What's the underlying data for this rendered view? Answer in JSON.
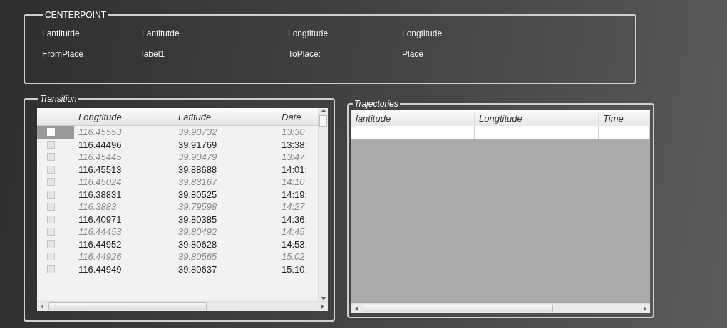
{
  "centerpoint": {
    "title": "CENTERPOINT",
    "rows": [
      [
        "Lantitutde",
        "Lantitutde",
        "Longtitude",
        "Longtitude"
      ],
      [
        "FromPlace",
        "label1",
        "ToPlace:",
        "Place"
      ]
    ]
  },
  "transition": {
    "title": "Transition",
    "columns": [
      "Longtitude",
      "Latitude",
      "Date"
    ],
    "rows": [
      {
        "kind": "alternate",
        "selected": true,
        "cells": [
          "116.45553",
          "39.90732",
          "13:30"
        ]
      },
      {
        "kind": "normal",
        "selected": false,
        "cells": [
          "116.44496",
          "39.91769",
          "13:38:"
        ]
      },
      {
        "kind": "alternate",
        "selected": false,
        "cells": [
          "116.45445",
          "39.90479",
          "13:47"
        ]
      },
      {
        "kind": "normal",
        "selected": false,
        "cells": [
          "116.45513",
          "39.88688",
          "14:01:"
        ]
      },
      {
        "kind": "alternate",
        "selected": false,
        "cells": [
          "116.45024",
          "39.83167",
          "14:10"
        ]
      },
      {
        "kind": "normal",
        "selected": false,
        "cells": [
          "116.38831",
          "39.80525",
          "14:19:"
        ]
      },
      {
        "kind": "alternate",
        "selected": false,
        "cells": [
          "116.3883",
          "39.79598",
          "14:27"
        ]
      },
      {
        "kind": "normal",
        "selected": false,
        "cells": [
          "116.40971",
          "39.80385",
          "14:36:"
        ]
      },
      {
        "kind": "alternate",
        "selected": false,
        "cells": [
          "116.44453",
          "39.80492",
          "14:45"
        ]
      },
      {
        "kind": "normal",
        "selected": false,
        "cells": [
          "116.44952",
          "39.80628",
          "14:53:"
        ]
      },
      {
        "kind": "alternate",
        "selected": false,
        "cells": [
          "116.44926",
          "39.80565",
          "15:02"
        ]
      },
      {
        "kind": "normal",
        "selected": false,
        "cells": [
          "116.44949",
          "39.80637",
          "15:10:"
        ]
      }
    ]
  },
  "trajectories": {
    "title": "Trajectories",
    "columns": [
      "lantitude",
      "Longtitude",
      "Time"
    ]
  }
}
